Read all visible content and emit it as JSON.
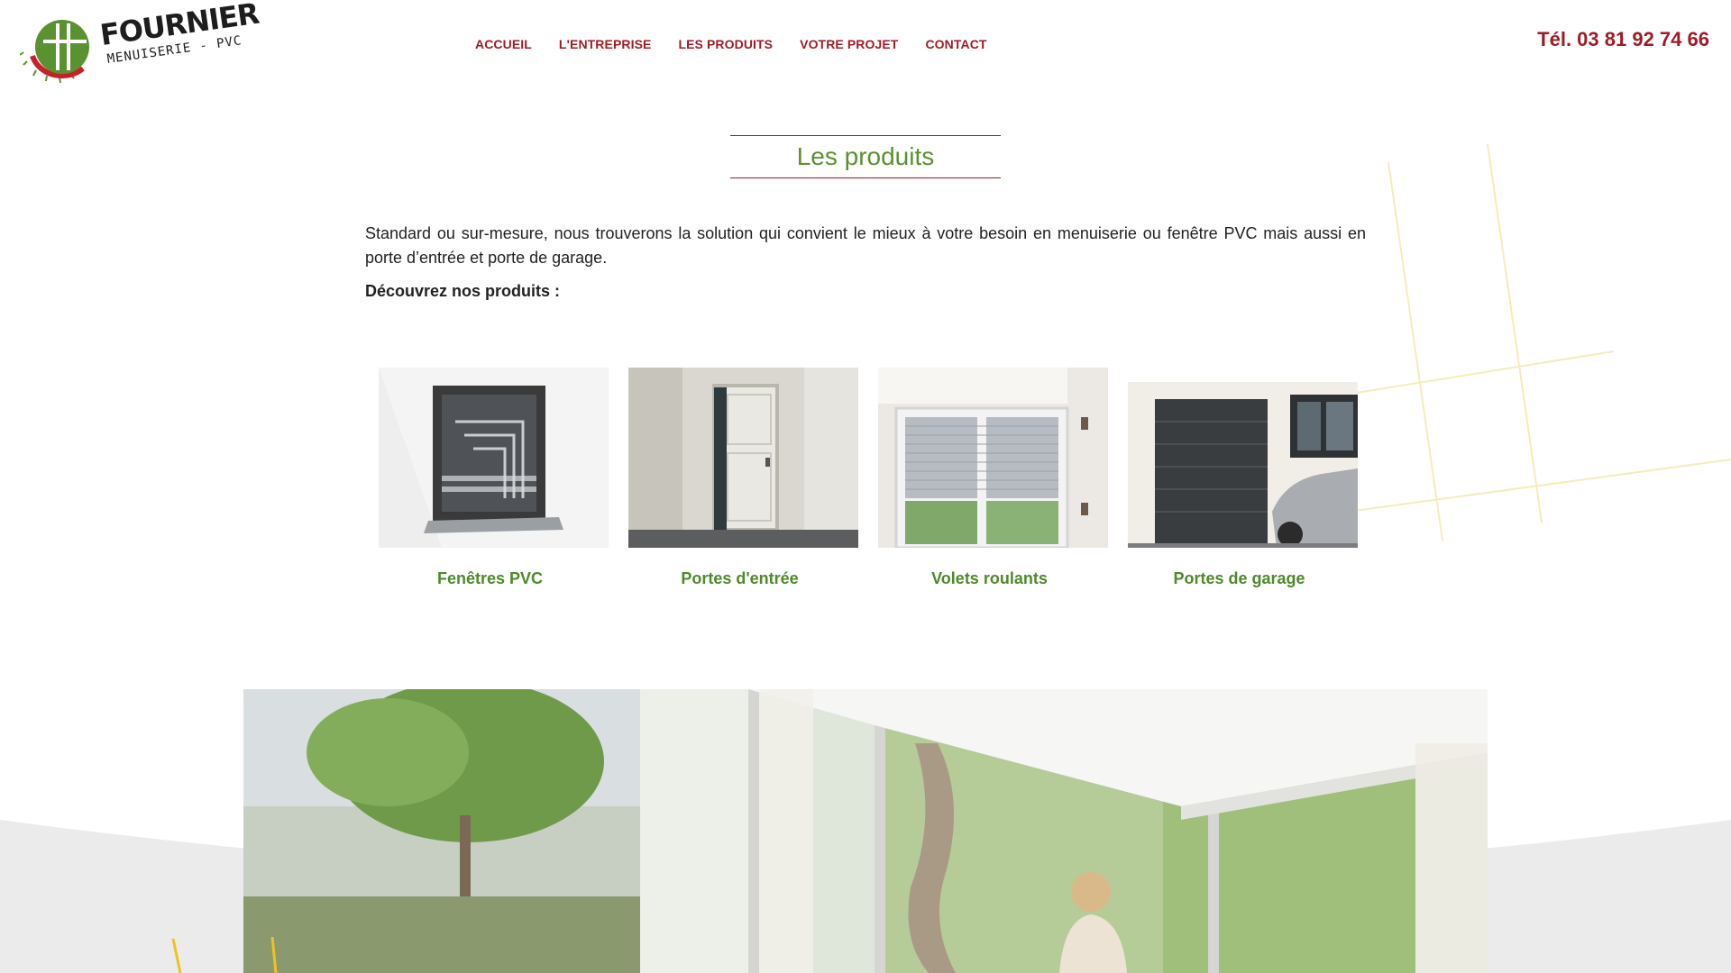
{
  "brand": {
    "name": "FOURNIER",
    "tagline": "MENUISERIE - PVC"
  },
  "nav": {
    "items": [
      {
        "label": "ACCUEIL"
      },
      {
        "label": "L'ENTREPRISE"
      },
      {
        "label": "LES PRODUITS"
      },
      {
        "label": "VOTRE PROJET"
      },
      {
        "label": "CONTACT"
      }
    ]
  },
  "header": {
    "phone": "Tél. 03 81 92 74 66"
  },
  "section": {
    "title": "Les produits",
    "intro": "Standard ou sur-mesure, nous trouverons la solution qui convient le mieux à votre besoin en menuiserie ou fenêtre PVC mais aussi en porte d’entrée et porte de garage.",
    "discover": "Découvrez nos produits :"
  },
  "products": [
    {
      "label": "Fenêtres PVC",
      "icon": "window-photo"
    },
    {
      "label": "Portes d'entrée",
      "icon": "door-photo"
    },
    {
      "label": "Volets roulants",
      "icon": "shutter-photo"
    },
    {
      "label": "Portes de garage",
      "icon": "garage-photo"
    }
  ],
  "colors": {
    "brand_red": "#a01c25",
    "brand_green": "#5b9231",
    "product_green": "#4e8a2b",
    "deco_yellow": "#f5e9a8"
  }
}
